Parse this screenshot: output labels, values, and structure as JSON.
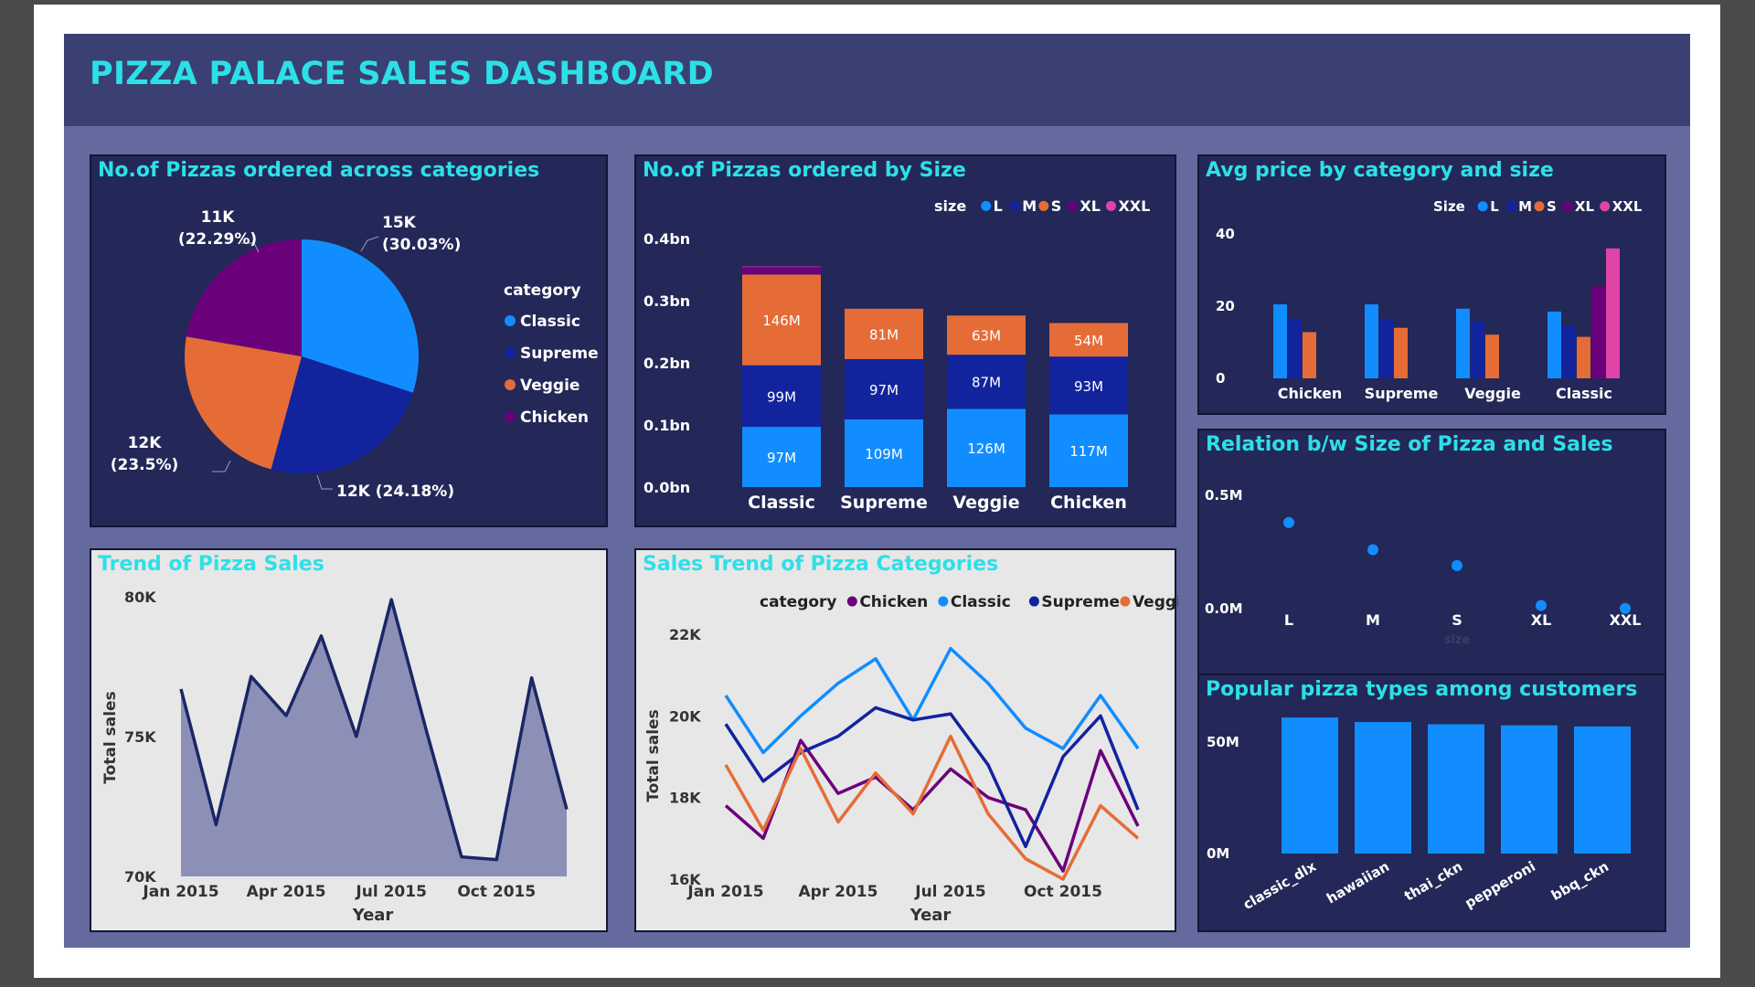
{
  "dashboard": {
    "title": "PIZZA PALACE SALES DASHBOARD",
    "colors": {
      "header_bg": "#3a4072",
      "canvas_bg": "#646a9d",
      "panel_dark": "#232858",
      "panel_light": "#e7e7e7",
      "title_cyan": "#2de0e8",
      "classic_L": "#118dff",
      "supreme_M": "#12239e",
      "veggie_S": "#e66c37",
      "chicken_XL": "#6b007b",
      "XXL": "#e044a7"
    }
  },
  "panels": {
    "pie": {
      "title": "No.of Pizzas ordered across categories"
    },
    "size": {
      "title": "No.of Pizzas ordered by Size"
    },
    "avg": {
      "title": "Avg price by category and size"
    },
    "rel": {
      "title": "Relation b/w Size of Pizza and Sales"
    },
    "pop": {
      "title": "Popular pizza types among customers"
    },
    "trend": {
      "title": "Trend of Pizza Sales"
    },
    "cat": {
      "title": "Sales Trend of Pizza Categories"
    }
  },
  "chart_data": [
    {
      "id": "pie",
      "type": "pie",
      "legend_title": "category",
      "slices": [
        {
          "name": "Classic",
          "value": 30.03,
          "label_line1": "15K",
          "label_line2": "(30.03%)",
          "color": "#118dff"
        },
        {
          "name": "Supreme",
          "value": 24.18,
          "label_line1": "12K (24.18%)",
          "label_line2": "",
          "color": "#12239e"
        },
        {
          "name": "Veggie",
          "value": 23.5,
          "label_line1": "12K",
          "label_line2": "(23.5%)",
          "color": "#e66c37"
        },
        {
          "name": "Chicken",
          "value": 22.29,
          "label_line1": "11K",
          "label_line2": "(22.29%)",
          "color": "#6b007b"
        }
      ]
    },
    {
      "id": "size",
      "type": "bar",
      "stacked": true,
      "legend_title": "size",
      "legend": [
        {
          "name": "L",
          "color": "#118dff"
        },
        {
          "name": "M",
          "color": "#12239e"
        },
        {
          "name": "S",
          "color": "#e66c37"
        },
        {
          "name": "XL",
          "color": "#6b007b"
        },
        {
          "name": "XXL",
          "color": "#e044a7"
        }
      ],
      "categories": [
        "Classic",
        "Supreme",
        "Veggie",
        "Chicken"
      ],
      "series": [
        {
          "name": "L",
          "color": "#118dff",
          "values": [
            97,
            109,
            126,
            117
          ],
          "labels": [
            "97M",
            "109M",
            "126M",
            "117M"
          ]
        },
        {
          "name": "M",
          "color": "#12239e",
          "values": [
            99,
            97,
            87,
            93
          ],
          "labels": [
            "99M",
            "97M",
            "87M",
            "93M"
          ]
        },
        {
          "name": "S",
          "color": "#e66c37",
          "values": [
            146,
            81,
            63,
            54
          ],
          "labels": [
            "146M",
            "81M",
            "63M",
            "54M"
          ]
        },
        {
          "name": "XL",
          "color": "#6b007b",
          "values": [
            12,
            0,
            0,
            0
          ],
          "labels": [
            "",
            "",
            "",
            ""
          ]
        },
        {
          "name": "XXL",
          "color": "#e044a7",
          "values": [
            1,
            0,
            0,
            0
          ],
          "labels": [
            "",
            "",
            "",
            ""
          ]
        }
      ],
      "ylim": [
        0,
        400
      ],
      "ticks": [
        0,
        100,
        200,
        300,
        400
      ],
      "tick_labels": [
        "0.0bn",
        "0.1bn",
        "0.2bn",
        "0.3bn",
        "0.4bn"
      ]
    },
    {
      "id": "avg",
      "type": "bar",
      "legend_title": "Size",
      "legend": [
        {
          "name": "L",
          "color": "#118dff"
        },
        {
          "name": "M",
          "color": "#12239e"
        },
        {
          "name": "S",
          "color": "#e66c37"
        },
        {
          "name": "XL",
          "color": "#6b007b"
        },
        {
          "name": "XXL",
          "color": "#e044a7"
        }
      ],
      "categories": [
        "Chicken",
        "Supreme",
        "Veggie",
        "Classic"
      ],
      "series": [
        {
          "name": "L",
          "color": "#118dff",
          "values": [
            20.5,
            20.5,
            19.3,
            18.5
          ]
        },
        {
          "name": "M",
          "color": "#12239e",
          "values": [
            16.5,
            16.5,
            15.8,
            14.6
          ]
        },
        {
          "name": "S",
          "color": "#e66c37",
          "values": [
            12.8,
            14.0,
            12.1,
            11.5
          ]
        },
        {
          "name": "XL",
          "color": "#6b007b",
          "values": [
            0,
            0,
            0,
            25.5
          ]
        },
        {
          "name": "XXL",
          "color": "#e044a7",
          "values": [
            0,
            0,
            0,
            36.0
          ]
        }
      ],
      "ylim": [
        0,
        40
      ],
      "ticks": [
        0,
        20,
        40
      ],
      "tick_labels": [
        "0",
        "20",
        "40"
      ]
    },
    {
      "id": "rel",
      "type": "scatter",
      "categories": [
        "L",
        "M",
        "S",
        "XL",
        "XXL"
      ],
      "values": [
        0.38,
        0.26,
        0.19,
        0.014,
        0.001
      ],
      "ylim": [
        0,
        0.5
      ],
      "ticks": [
        0,
        0.5
      ],
      "tick_labels": [
        "0.0M",
        "0.5M"
      ],
      "xlabel": "size",
      "color": "#118dff"
    },
    {
      "id": "pop",
      "type": "bar",
      "categories": [
        "classic_dlx",
        "hawaiian",
        "thai_ckn",
        "pepperoni",
        "bbq_ckn"
      ],
      "values": [
        61,
        59,
        58,
        57.5,
        57
      ],
      "ylim": [
        0,
        60
      ],
      "ticks": [
        0,
        50
      ],
      "tick_labels": [
        "0M",
        "50M"
      ],
      "color": "#118dff"
    },
    {
      "id": "trend",
      "type": "area",
      "x": [
        "2015-01",
        "2015-02",
        "2015-03",
        "2015-04",
        "2015-05",
        "2015-06",
        "2015-07",
        "2015-08",
        "2015-09",
        "2015-10",
        "2015-11",
        "2015-12"
      ],
      "values": [
        76700,
        71850,
        77150,
        75750,
        78600,
        75000,
        79900,
        75200,
        70700,
        70600,
        77100,
        72400
      ],
      "ylim": [
        70000,
        80000
      ],
      "ticks": [
        70000,
        75000,
        80000
      ],
      "tick_labels": [
        "70K",
        "75K",
        "80K"
      ],
      "xtick_idx": [
        0,
        3,
        6,
        9
      ],
      "xtick_labels": [
        "Jan 2015",
        "Apr 2015",
        "Jul 2015",
        "Oct 2015"
      ],
      "xlabel": "Year",
      "ylabel": "Total sales",
      "line_color": "#1a2766",
      "fill_color": "#8d90b6"
    },
    {
      "id": "cat",
      "type": "line",
      "legend_title": "category",
      "legend": [
        {
          "name": "Chicken",
          "color": "#6b007b"
        },
        {
          "name": "Classic",
          "color": "#118dff"
        },
        {
          "name": "Supreme",
          "color": "#12239e"
        },
        {
          "name": "Veggie",
          "color": "#e66c37"
        }
      ],
      "x": [
        "2015-01",
        "2015-02",
        "2015-03",
        "2015-04",
        "2015-05",
        "2015-06",
        "2015-07",
        "2015-08",
        "2015-09",
        "2015-10",
        "2015-11",
        "2015-12"
      ],
      "series": [
        {
          "name": "Chicken",
          "color": "#6b007b",
          "values": [
            17800,
            17000,
            19400,
            18100,
            18500,
            17700,
            18700,
            18000,
            17700,
            16200,
            19150,
            17300
          ]
        },
        {
          "name": "Classic",
          "color": "#118dff",
          "values": [
            20500,
            19100,
            20000,
            20800,
            21400,
            19900,
            21650,
            20800,
            19700,
            19200,
            20500,
            19200
          ]
        },
        {
          "name": "Supreme",
          "color": "#12239e",
          "values": [
            19800,
            18400,
            19100,
            19500,
            20200,
            19900,
            20050,
            18800,
            16800,
            19000,
            20000,
            17700
          ]
        },
        {
          "name": "Veggie",
          "color": "#e66c37",
          "values": [
            18800,
            17200,
            19200,
            17400,
            18600,
            17600,
            19500,
            17600,
            16500,
            16000,
            17800,
            17000
          ]
        }
      ],
      "ylim": [
        16000,
        22000
      ],
      "ticks": [
        16000,
        18000,
        20000,
        22000
      ],
      "tick_labels": [
        "16K",
        "18K",
        "20K",
        "22K"
      ],
      "xtick_idx": [
        0,
        3,
        6,
        9
      ],
      "xtick_labels": [
        "Jan 2015",
        "Apr 2015",
        "Jul 2015",
        "Oct 2015"
      ],
      "xlabel": "Year",
      "ylabel": "Total sales"
    }
  ]
}
